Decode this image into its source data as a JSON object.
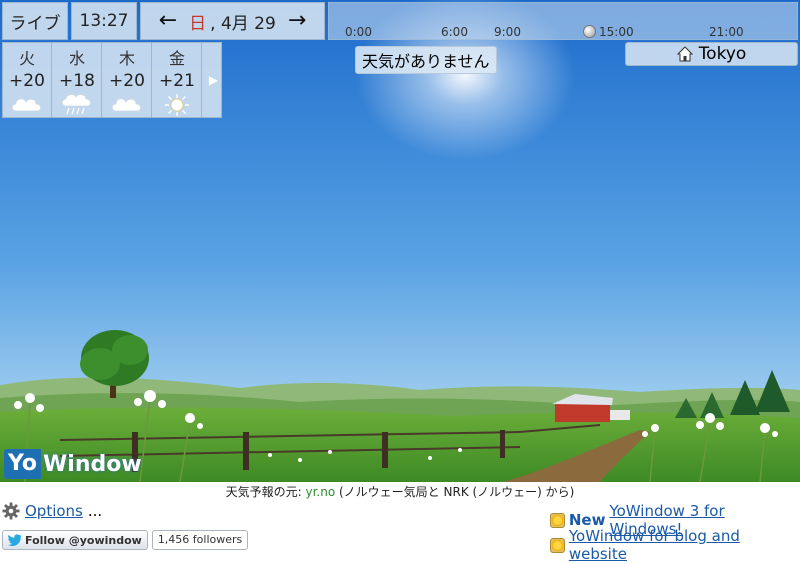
{
  "topbar": {
    "live_label": "ライブ",
    "time": "13:27",
    "prev_arrow": "←",
    "next_arrow": "→",
    "date_dow": "日",
    "date_rest": ", 4月 29"
  },
  "timeline": {
    "ticks": [
      "0:00",
      "6:00",
      "9:00",
      "15:00",
      "21:00"
    ]
  },
  "forecast": {
    "days": [
      {
        "name": "火",
        "temp": "+20",
        "icon": "cloud-icon"
      },
      {
        "name": "水",
        "temp": "+18",
        "icon": "cloud-rain-icon"
      },
      {
        "name": "木",
        "temp": "+20",
        "icon": "cloud-icon"
      },
      {
        "name": "金",
        "temp": "+21",
        "icon": "sun-icon"
      }
    ],
    "more_arrow": "▶"
  },
  "status": {
    "no_weather": "天気がありません"
  },
  "location": {
    "name": "Tokyo",
    "icon": "home-icon"
  },
  "logo": {
    "part1": "Yo",
    "part2": "Window"
  },
  "footer": {
    "credit_prefix": "天気予報の元: ",
    "credit_source": "yr.no",
    "credit_suffix": " (ノルウェー気局と NRK (ノルウェー) から)",
    "options_label": "Options",
    "options_ellipsis": "...",
    "follow_label": "Follow @yowindow",
    "followers": "1,456 followers",
    "promo1_bold": "New",
    "promo1_link": "YoWindow 3 for Windows!",
    "promo2_link": "YoWindow for blog and website"
  },
  "colors": {
    "sky_top": "#1e6fce",
    "sky_bottom": "#bfe0f4",
    "grass": "#4f9a2e",
    "link": "#1a5aa8",
    "logo_blue": "#1f6fb3"
  }
}
